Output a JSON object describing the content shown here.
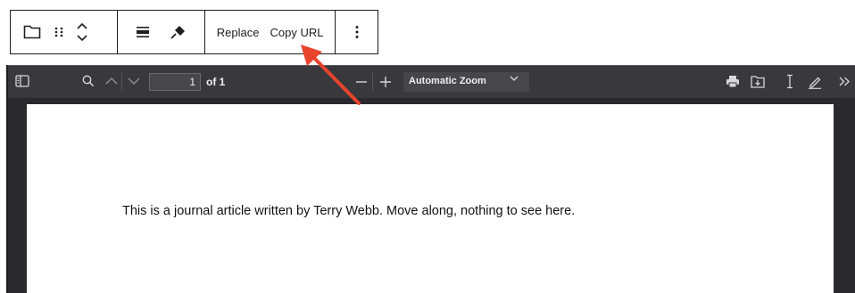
{
  "block_toolbar": {
    "replace_label": "Replace",
    "copy_url_label": "Copy URL"
  },
  "pdf_viewer": {
    "page_number": "1",
    "page_count": "of 1",
    "zoom_selected": "Automatic Zoom"
  },
  "document": {
    "text": "This is a journal article written by Terry Webb. Move along, nothing to see here."
  },
  "colors": {
    "annotation_arrow": "#e8432d",
    "viewer_toolbar": "#38383d",
    "viewer_background": "#2a2a2e"
  }
}
